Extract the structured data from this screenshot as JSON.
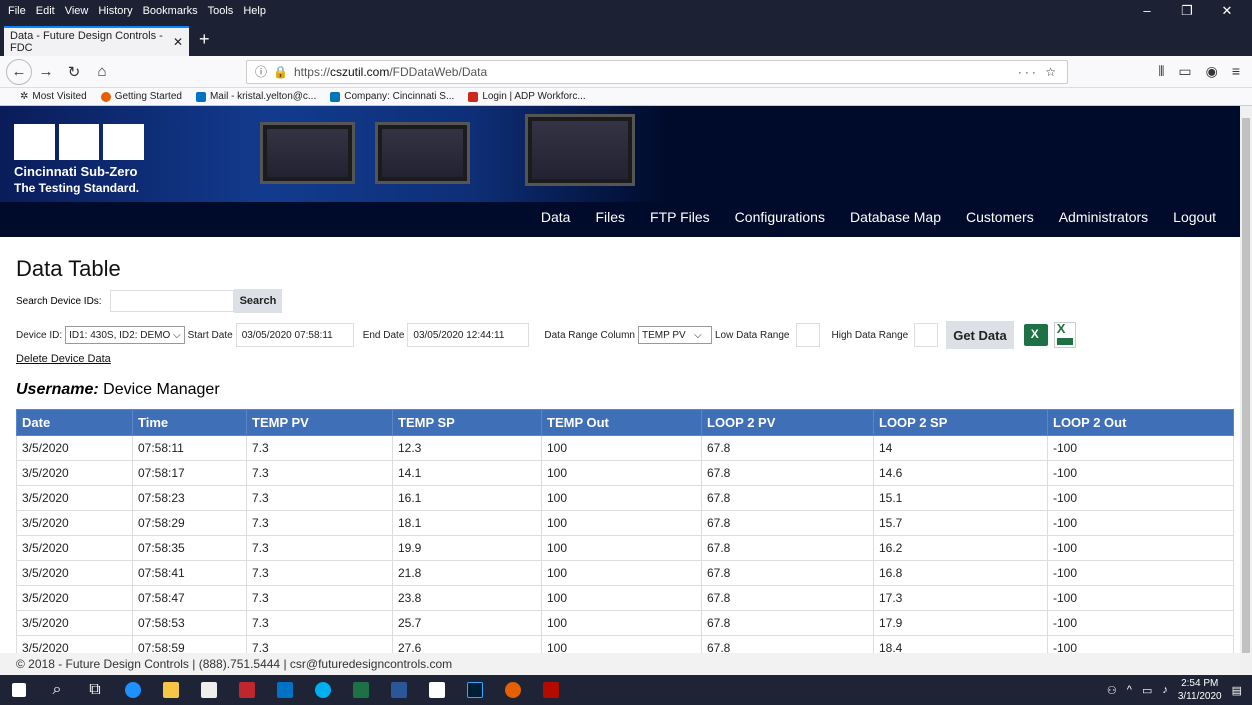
{
  "browser": {
    "menu": [
      "File",
      "Edit",
      "View",
      "History",
      "Bookmarks",
      "Tools",
      "Help"
    ],
    "tab_title": "Data - Future Design Controls - FDC",
    "url_prefix": "https://",
    "url_host": "cszutil.com",
    "url_path": "/FDDataWeb/Data",
    "bookmarks": [
      "Most Visited",
      "Getting Started",
      "Mail - kristal.yelton@c...",
      "Company: Cincinnati S...",
      "Login | ADP Workforc..."
    ]
  },
  "site": {
    "logo_line1": "Cincinnati Sub-Zero",
    "logo_line2": "The Testing Standard.",
    "nav": [
      "Data",
      "Files",
      "FTP Files",
      "Configurations",
      "Database Map",
      "Customers",
      "Administrators",
      "Logout"
    ]
  },
  "page": {
    "title": "Data Table",
    "search_label": "Search Device IDs:",
    "search_button": "Search",
    "device_label": "Device ID:",
    "device_value": "ID1: 430S, ID2: DEMO",
    "start_label": "Start Date",
    "start_value": "03/05/2020 07:58:11",
    "end_label": "End Date",
    "end_value": "03/05/2020 12:44:11",
    "range_col_label": "Data Range Column",
    "range_col_value": "TEMP PV",
    "low_label": "Low Data Range",
    "high_label": "High Data Range",
    "get_data_button": "Get Data",
    "delete_link": "Delete Device Data",
    "username_label": "Username:",
    "username_value": "Device Manager"
  },
  "table": {
    "headers": [
      "Date",
      "Time",
      "TEMP PV",
      "TEMP SP",
      "TEMP Out",
      "LOOP 2 PV",
      "LOOP 2 SP",
      "LOOP 2 Out"
    ],
    "rows": [
      [
        "3/5/2020",
        "07:58:11",
        "7.3",
        "12.3",
        "100",
        "67.8",
        "14",
        "-100"
      ],
      [
        "3/5/2020",
        "07:58:17",
        "7.3",
        "14.1",
        "100",
        "67.8",
        "14.6",
        "-100"
      ],
      [
        "3/5/2020",
        "07:58:23",
        "7.3",
        "16.1",
        "100",
        "67.8",
        "15.1",
        "-100"
      ],
      [
        "3/5/2020",
        "07:58:29",
        "7.3",
        "18.1",
        "100",
        "67.8",
        "15.7",
        "-100"
      ],
      [
        "3/5/2020",
        "07:58:35",
        "7.3",
        "19.9",
        "100",
        "67.8",
        "16.2",
        "-100"
      ],
      [
        "3/5/2020",
        "07:58:41",
        "7.3",
        "21.8",
        "100",
        "67.8",
        "16.8",
        "-100"
      ],
      [
        "3/5/2020",
        "07:58:47",
        "7.3",
        "23.8",
        "100",
        "67.8",
        "17.3",
        "-100"
      ],
      [
        "3/5/2020",
        "07:58:53",
        "7.3",
        "25.7",
        "100",
        "67.8",
        "17.9",
        "-100"
      ],
      [
        "3/5/2020",
        "07:58:59",
        "7.3",
        "27.6",
        "100",
        "67.8",
        "18.4",
        "-100"
      ]
    ]
  },
  "footer": "© 2018 - Future Design Controls | (888).751.5444 | csr@futuredesigncontrols.com",
  "taskbar": {
    "time": "2:54 PM",
    "date": "3/11/2020"
  },
  "colors": {
    "header_bg": "#000a2a",
    "table_header": "#3f6fb6",
    "browser_dark": "#1c2233"
  }
}
